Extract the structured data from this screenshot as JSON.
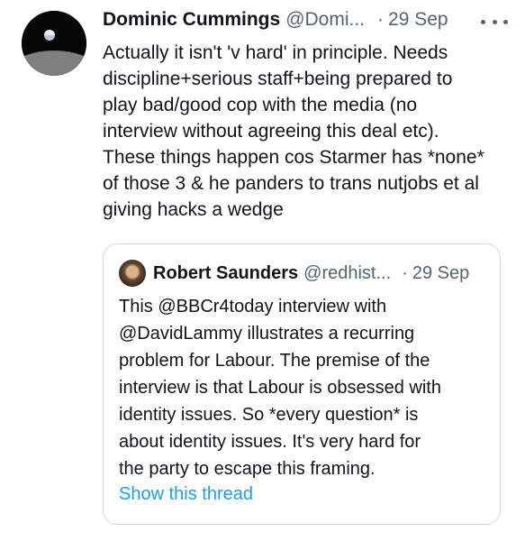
{
  "tweet": {
    "author_name": "Dominic Cummings",
    "author_handle": "@Domi...",
    "separator": "·",
    "date": "29 Sep",
    "text": "Actually it isn't 'v hard' in principle. Needs\ndiscipline+serious staff+being prepared to\nplay bad/good cop with the media (no\ninterview without agreeing this deal etc).\nThese things happen cos Starmer has *none*\nof those 3 & he panders to trans nutjobs et al\ngiving hacks a wedge"
  },
  "quoted_tweet": {
    "author_name": "Robert Saunders",
    "author_handle": "@redhist...",
    "separator": "·",
    "date": "29 Sep",
    "text": "This @BBCr4today interview with\n@DavidLammy illustrates a recurring\nproblem for Labour. The premise of the\ninterview is that Labour is obsessed with\nidentity issues. So *every question* is\nabout identity issues. It's very hard for\nthe party to escape this framing.",
    "show_thread_label": "Show this thread"
  },
  "colors": {
    "text_primary": "#0f1419",
    "text_secondary": "#536471",
    "link": "#1d9bf0",
    "border": "#cfd9de"
  },
  "icons": {
    "more": "more-options-icon"
  }
}
